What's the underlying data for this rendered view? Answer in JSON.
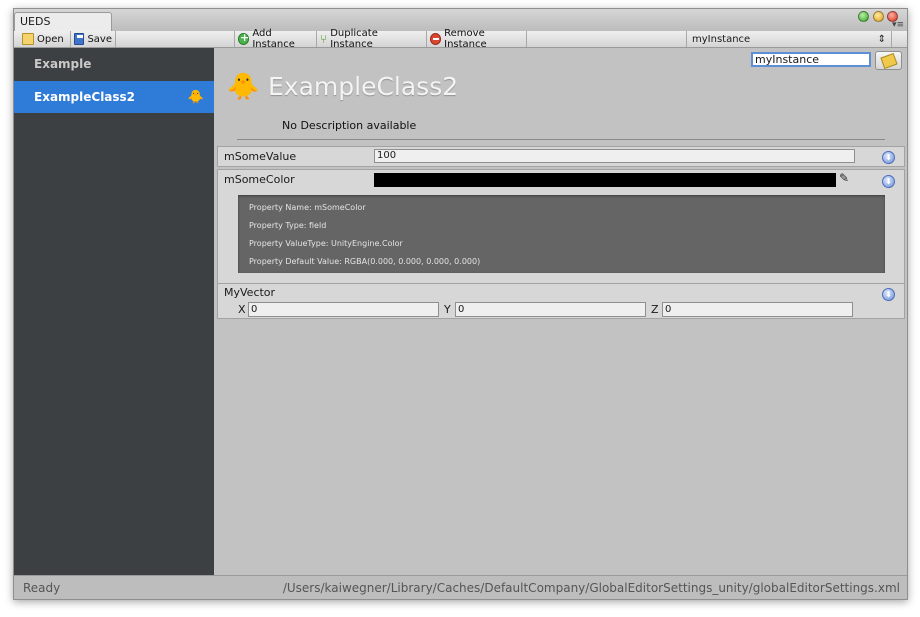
{
  "window": {
    "tab_title": "UEDS"
  },
  "toolbar": {
    "open_label": "Open",
    "save_label": "Save",
    "add_instance_label": "Add Instance",
    "duplicate_instance_label": "Duplicate Instance",
    "remove_instance_label": "Remove Instance",
    "instance_dropdown_value": "myInstance"
  },
  "sidebar": {
    "items": [
      {
        "label": "Example",
        "selected": false
      },
      {
        "label": "ExampleClass2",
        "selected": true,
        "icon": "duck-icon"
      }
    ]
  },
  "main": {
    "instance_name_value": "myInstance",
    "class_title": "ExampleClass2",
    "description": "No Description available",
    "properties": {
      "some_value": {
        "label": "mSomeValue",
        "value": "100"
      },
      "some_color": {
        "label": "mSomeColor",
        "color": "#000000",
        "details": [
          "Property Name: mSomeColor",
          "Property Type: field",
          "Property ValueType: UnityEngine.Color",
          "Property Default Value: RGBA(0.000, 0.000, 0.000, 0.000)"
        ]
      },
      "my_vector": {
        "label": "MyVector",
        "x_label": "X",
        "x_value": "0",
        "y_label": "Y",
        "y_value": "0",
        "z_label": "Z",
        "z_value": "0"
      }
    }
  },
  "statusbar": {
    "status": "Ready",
    "path": "/Users/kaiwegner/Library/Caches/DefaultCompany/GlobalEditorSettings_unity/globalEditorSettings.xml"
  },
  "colors": {
    "sidebar_bg": "#3d4042",
    "selection": "#2f7bd8",
    "panel_bg": "#c2c2c2"
  }
}
